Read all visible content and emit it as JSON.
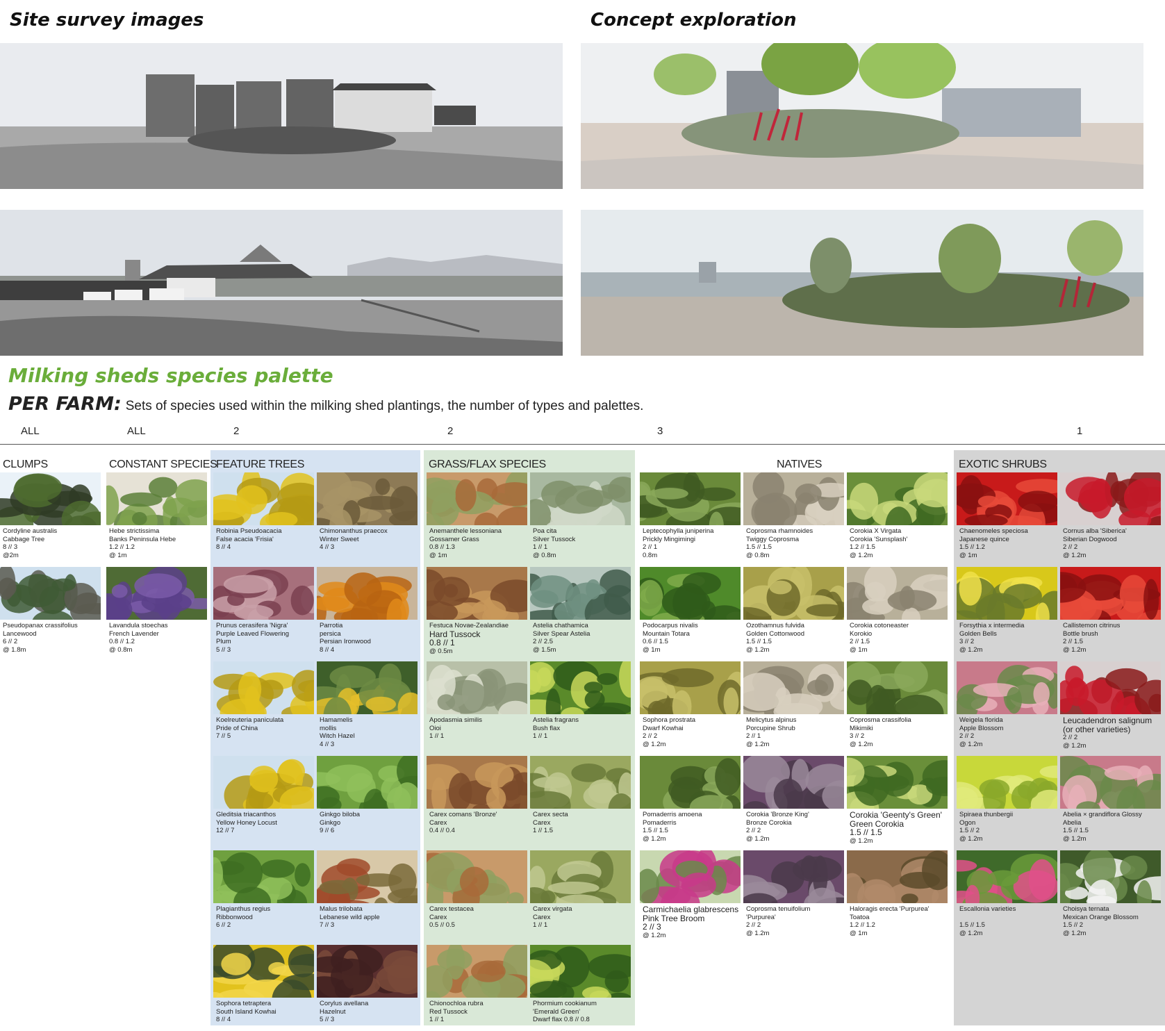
{
  "headers": {
    "site_survey": "Site survey images",
    "concept": "Concept exploration"
  },
  "palette": {
    "title": "Milking sheds species palette",
    "per_farm_label": "PER FARM:",
    "per_farm_text": "Sets of species used within the milking shed plantings, the number of types and palettes."
  },
  "counts": [
    "ALL",
    "ALL",
    "2",
    "2",
    "3",
    "1"
  ],
  "columns": [
    {
      "title": "CLUMPS",
      "cards": [
        {
          "lines": [
            "Cordyline australis",
            "Cabbage Tree",
            "8 // 3",
            "@2m"
          ],
          "img": "cabbage-tree"
        },
        {
          "lines": [
            "Pseudopanax crassifolius",
            "Lancewood",
            "6 // 2",
            "@ 1.8m"
          ],
          "img": "lancewood"
        }
      ]
    },
    {
      "title": "CONSTANT SPECIES",
      "cards": [
        {
          "lines": [
            "Hebe strictissima",
            "Banks Peninsula Hebe",
            "1.2 // 1.2",
            "@ 1m"
          ],
          "img": "hebe"
        },
        {
          "lines": [
            "Lavandula stoechas",
            "French Lavender",
            "0.8 // 1.2",
            "@ 0.8m"
          ],
          "img": "lavender"
        }
      ]
    },
    {
      "title": "FEATURE TREES",
      "cards": [
        {
          "lines": [
            "Robinia Pseudoacacia",
            "False acacia 'Frisia'",
            "8 // 4"
          ],
          "img": "yellow-tree"
        },
        {
          "lines": [
            "Chimonanthus praecox",
            "Winter Sweet",
            "4 // 3"
          ],
          "img": "brown-shrub"
        },
        {
          "lines": [
            "Prunus cerasifera 'Nigra'",
            "Purple Leaved Flowering",
            "Plum",
            "5 // 3"
          ],
          "img": "plum-tree"
        },
        {
          "lines": [
            "Parrotia",
            "persica",
            "Persian Ironwood",
            "8 // 4"
          ],
          "img": "orange-tree"
        },
        {
          "lines": [
            "Koelreuteria paniculata",
            "Pride of China",
            "7 // 5"
          ],
          "img": "yellow-tree"
        },
        {
          "lines": [
            "Hamamelis",
            "mollis",
            "Witch Hazel",
            "4 // 3"
          ],
          "img": "witch-hazel"
        },
        {
          "lines": [
            "Gleditsia triacanthos",
            "Yellow Honey Locust",
            "12 // 7"
          ],
          "img": "yellow-tree"
        },
        {
          "lines": [
            "Ginkgo biloba",
            "Ginkgo",
            "9 // 6"
          ],
          "img": "green-tree"
        },
        {
          "lines": [
            "Plagianthus regius",
            "Ribbonwood",
            "6 // 2"
          ],
          "img": "green-tree"
        },
        {
          "lines": [
            "Malus trilobata",
            "Lebanese wild apple",
            "7 // 3"
          ],
          "img": "apple"
        },
        {
          "lines": [
            "Sophora tetraptera",
            "South Island Kowhai",
            "8 // 4"
          ],
          "img": "kowhai"
        },
        {
          "lines": [
            "Corylus avellana",
            "Hazelnut",
            "5 // 3"
          ],
          "img": "hazel"
        }
      ]
    },
    {
      "title": "GRASS/FLAX SPECIES",
      "cards": [
        {
          "lines": [
            "Anemanthele lessoniana",
            "Gossamer Grass",
            "0.8 // 1.3",
            "@ 1m"
          ],
          "img": "orange-grass"
        },
        {
          "lines": [
            "Poa cita",
            "Silver Tussock",
            "1 // 1",
            "@ 0.8m"
          ],
          "img": "silver-grass"
        },
        {
          "lines": [
            "Festuca Novae-Zealandiae",
            "Hard Tussock",
            "0.8 // 1",
            "@ 0.5m"
          ],
          "big": [
            1,
            2
          ],
          "img": "brown-grass"
        },
        {
          "lines": [
            "Astelia chathamica",
            "Silver Spear Astelia",
            "2 // 2.5",
            "@ 1.5m"
          ],
          "img": "astelia"
        },
        {
          "lines": [
            "Apodasmia similis",
            "Oioi",
            "1 // 1"
          ],
          "img": "reeds"
        },
        {
          "lines": [
            "Astelia fragrans",
            "Bush flax",
            "1 // 1"
          ],
          "img": "flax"
        },
        {
          "lines": [
            "Carex comans 'Bronze'",
            "Carex",
            "0.4 // 0.4"
          ],
          "img": "brown-grass"
        },
        {
          "lines": [
            "Carex secta",
            "Carex",
            "1 // 1.5"
          ],
          "img": "green-grass"
        },
        {
          "lines": [
            "Carex testacea",
            "Carex",
            "0.5 // 0.5"
          ],
          "img": "orange-grass"
        },
        {
          "lines": [
            "Carex virgata",
            "Carex",
            "1 // 1"
          ],
          "img": "green-grass"
        },
        {
          "lines": [
            "Chionochloa rubra",
            "Red Tussock",
            "1 // 1"
          ],
          "img": "orange-grass"
        },
        {
          "lines": [
            "Phormium cookianum",
            "'Emerald Green'",
            "Dwarf flax 0.8 // 0.8"
          ],
          "img": "flax"
        }
      ]
    },
    {
      "title": "NATIVES",
      "cards": [
        {
          "lines": [
            "Leptecophylla juniperina",
            "Prickly Mingimingi",
            "2 // 1",
            "0.8m"
          ],
          "img": "green-shrub"
        },
        {
          "lines": [
            "Coprosma rhamnoides",
            "Twiggy Coprosma",
            "1.5 // 1.5",
            "@ 0.8m"
          ],
          "img": "twiggy"
        },
        {
          "lines": [
            "Corokia X Virgata",
            "Corokia 'Sunsplash'",
            "1.2 // 1.5",
            "@ 1.2m"
          ],
          "img": "leafy"
        },
        {
          "lines": [
            "Podocarpus nivalis",
            "Mountain Totara",
            "0.6 // 1.5",
            "@ 1m"
          ],
          "img": "totara"
        },
        {
          "lines": [
            "Ozothamnus fulvida",
            "Golden Cottonwood",
            "1.5 // 1.5",
            "@ 1.2m"
          ],
          "img": "olive-shrub"
        },
        {
          "lines": [
            "Corokia cotoneaster",
            "Korokio",
            "2 // 1.5",
            "@ 1m"
          ],
          "img": "twiggy"
        },
        {
          "lines": [
            "Sophora prostrata",
            "Dwarf Kowhai",
            "2 // 2",
            "@ 1.2m"
          ],
          "img": "olive-shrub"
        },
        {
          "lines": [
            "Melicytus alpinus",
            "Porcupine Shrub",
            "2 // 1",
            "@ 1.2m"
          ],
          "img": "twiggy"
        },
        {
          "lines": [
            "Coprosma crassifolia",
            "Mikimiki",
            "3 // 2",
            "@ 1.2m"
          ],
          "img": "green-shrub"
        },
        {
          "lines": [
            "Pomaderris amoena",
            "Pomaderris",
            "1.5 // 1.5",
            "@ 1.2m"
          ],
          "img": "green-shrub"
        },
        {
          "lines": [
            "Corokia 'Bronze King'",
            "Bronze Corokia",
            "2 // 2",
            "@ 1.2m"
          ],
          "img": "purple-shrub"
        },
        {
          "lines": [
            "Corokia 'Geenty's Green'",
            "Green Corokia",
            "1.5 // 1.5",
            "@ 1.2m"
          ],
          "big": [
            0,
            1,
            2
          ],
          "img": "leafy"
        },
        {
          "lines": [
            "Carmichaelia glabrescens",
            "Pink Tree Broom",
            "2 // 3",
            "@ 1.2m"
          ],
          "big": [
            0,
            1,
            2
          ],
          "img": "pink-flower"
        },
        {
          "lines": [
            "Coprosma tenuifolium",
            "'Purpurea'",
            "2 // 2",
            "@ 1.2m"
          ],
          "img": "purple-shrub"
        },
        {
          "lines": [
            "Haloragis erecta 'Purpurea'",
            "Toatoa",
            "1.2 // 1.2",
            "@ 1m"
          ],
          "img": "bronze-shrub"
        }
      ]
    },
    {
      "title": "EXOTIC SHRUBS",
      "cards": [
        {
          "lines": [
            "Chaenomeles speciosa",
            "Japanese quince",
            "1.5 // 1.2",
            "@ 1m"
          ],
          "img": "red-flower"
        },
        {
          "lines": [
            "Cornus alba 'Siberica'",
            "Siberian Dogwood",
            "2 // 2",
            "@ 1.2m"
          ],
          "img": "red-stems"
        },
        {
          "lines": [
            "Forsythia x intermedia",
            "Golden Bells",
            "3 // 2",
            "@ 1.2m"
          ],
          "img": "yellow-shrub"
        },
        {
          "lines": [
            "Callistemon citrinus",
            "Bottle brush",
            "2 // 1.5",
            "@ 1.2m"
          ],
          "img": "red-flower"
        },
        {
          "lines": [
            "Weigela florida",
            "Apple Blossom",
            "2 // 2",
            "@ 1.2m"
          ],
          "img": "pink-shrub"
        },
        {
          "lines": [
            "Leucadendron salignum",
            "(or other varieties)",
            "2 // 2",
            "@ 1.2m"
          ],
          "big": [
            0,
            1
          ],
          "img": "red-stems"
        },
        {
          "lines": [
            "Spiraea thunbergii",
            "Ogon",
            "1.5 // 2",
            "@ 1.2m"
          ],
          "img": "lime-shrub"
        },
        {
          "lines": [
            "Abelia × grandiflora Glossy",
            "Abelia",
            "1.5 // 1.5",
            "@ 1.2m"
          ],
          "img": "pink-shrub"
        },
        {
          "lines": [
            "Escallonia varieties",
            "",
            "1.5 // 1.5",
            "@ 1.2m"
          ],
          "img": "pink-flower-green"
        },
        {
          "lines": [
            "Choisya ternata",
            "Mexican Orange Blossom",
            "1.5 // 2",
            "@ 1.2m"
          ],
          "img": "white-flower"
        }
      ]
    }
  ]
}
